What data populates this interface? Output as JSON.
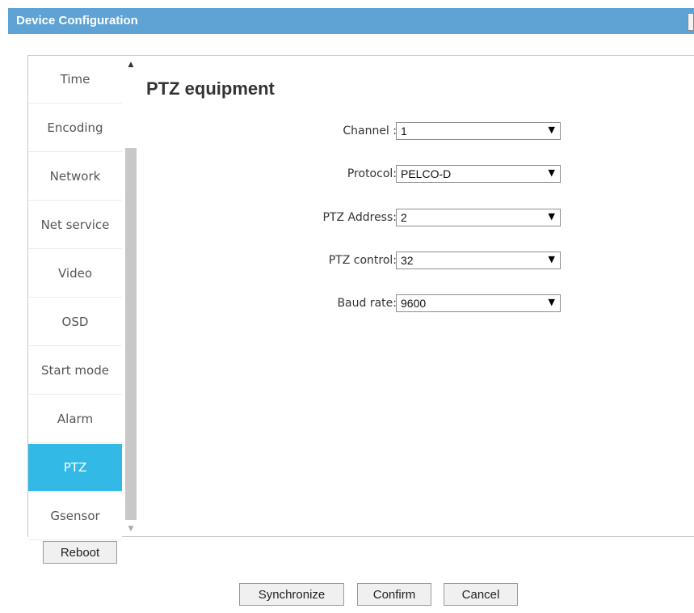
{
  "window": {
    "title": "Device Configuration"
  },
  "sidebar": {
    "items": [
      {
        "label": "Time",
        "active": false
      },
      {
        "label": "Encoding",
        "active": false
      },
      {
        "label": "Network",
        "active": false
      },
      {
        "label": "Net service",
        "active": false
      },
      {
        "label": "Video",
        "active": false
      },
      {
        "label": "OSD",
        "active": false
      },
      {
        "label": "Start mode",
        "active": false
      },
      {
        "label": "Alarm",
        "active": false
      },
      {
        "label": "PTZ",
        "active": true
      },
      {
        "label": "Gsensor",
        "active": false
      }
    ],
    "scroll_up_icon": "triangle-up-icon",
    "scroll_down_icon": "triangle-down-icon"
  },
  "main": {
    "heading": "PTZ equipment",
    "fields": {
      "channel": {
        "label": "Channel :",
        "value": "1"
      },
      "protocol": {
        "label": "Protocol:",
        "value": "PELCO-D"
      },
      "ptz_address": {
        "label": "PTZ Address:",
        "value": "2"
      },
      "ptz_control": {
        "label": "PTZ control:",
        "value": "32"
      },
      "baud_rate": {
        "label": "Baud rate:",
        "value": "9600"
      }
    }
  },
  "buttons": {
    "reboot": "Reboot",
    "synchronize": "Synchronize",
    "confirm": "Confirm",
    "cancel": "Cancel"
  },
  "colors": {
    "titlebar": "#5ea3d4",
    "active_nav": "#33b9e6"
  }
}
